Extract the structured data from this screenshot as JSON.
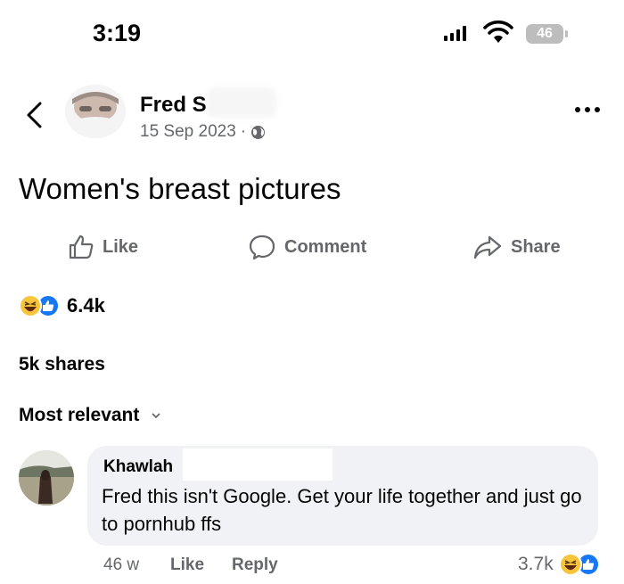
{
  "status_bar": {
    "time": "3:19",
    "battery": "46"
  },
  "post": {
    "author": "Fred S",
    "date": "15 Sep 2023",
    "separator": "·",
    "text": "Women's breast pictures"
  },
  "actions": {
    "like": "Like",
    "comment": "Comment",
    "share": "Share"
  },
  "reactions": {
    "count": "6.4k",
    "types": [
      "haha",
      "like"
    ]
  },
  "shares": "5k shares",
  "sort": {
    "label": "Most relevant"
  },
  "comment": {
    "author": "Khawlah",
    "text": "Fred this isn't Google. Get your life together and just go to pornhub ffs",
    "time": "46 w",
    "like": "Like",
    "reply": "Reply",
    "reaction_count": "3.7k"
  },
  "colors": {
    "text": "#050505",
    "secondary": "#65676b",
    "like_blue": "#1877f2",
    "haha_yellow": "#f7c53b",
    "bubble": "#f0f2f5"
  },
  "icons": [
    "back-chevron-icon",
    "globe-icon",
    "more-icon",
    "like-icon",
    "comment-icon",
    "share-icon",
    "haha-reaction-icon",
    "like-reaction-icon",
    "chevron-down-icon"
  ]
}
